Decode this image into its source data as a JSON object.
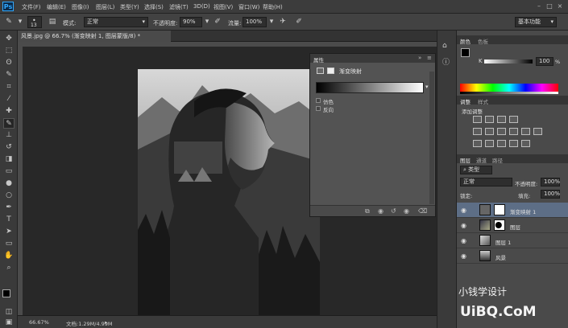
{
  "app": {
    "logo": "Ps"
  },
  "menu": [
    "文件(F)",
    "编辑(E)",
    "图像(I)",
    "图层(L)",
    "类型(Y)",
    "选择(S)",
    "滤镜(T)",
    "3D(D)",
    "视图(V)",
    "窗口(W)",
    "帮助(H)"
  ],
  "window_controls": [
    "–",
    "□",
    "×"
  ],
  "options": {
    "brush_size": "13",
    "mode_label": "模式:",
    "mode_value": "正常",
    "opacity_label": "不透明度:",
    "opacity_value": "90%",
    "flow_label": "流量:",
    "flow_value": "100%",
    "workspace": "基本功能"
  },
  "document": {
    "tab_title": "风景.jpg @ 66.7% (渐变映射 1, 图层蒙版/8) *",
    "zoom": "66.67%",
    "doc_info": "文档:1.29M/4.99M"
  },
  "properties": {
    "title": "属性",
    "type_label": "渐变映射",
    "dither_label": "仿色",
    "reverse_label": "反向"
  },
  "color_panel": {
    "tabs": [
      "颜色",
      "色板"
    ],
    "channel_label": "K",
    "value": "100",
    "unit": "%"
  },
  "adjust_panel": {
    "tabs": [
      "调整",
      "样式"
    ],
    "add_label": "添加调整"
  },
  "layers_panel": {
    "tabs": [
      "图层",
      "通道",
      "路径"
    ],
    "filter_kind": "类型",
    "blend_mode": "正常",
    "opacity_label": "不透明度:",
    "opacity_value": "100%",
    "lock_label": "锁定:",
    "fill_label": "填充:",
    "fill_value": "100%",
    "layers": [
      {
        "name": "渐变映射 1"
      },
      {
        "name": "图层"
      },
      {
        "name": "图层 1"
      },
      {
        "name": "风景"
      }
    ]
  },
  "watermark": {
    "text1": "小钱学设计",
    "text2": "UiBQ.CoM"
  },
  "colors": {
    "accent": "#31a8ff",
    "selected_layer": "#5d6e86"
  }
}
